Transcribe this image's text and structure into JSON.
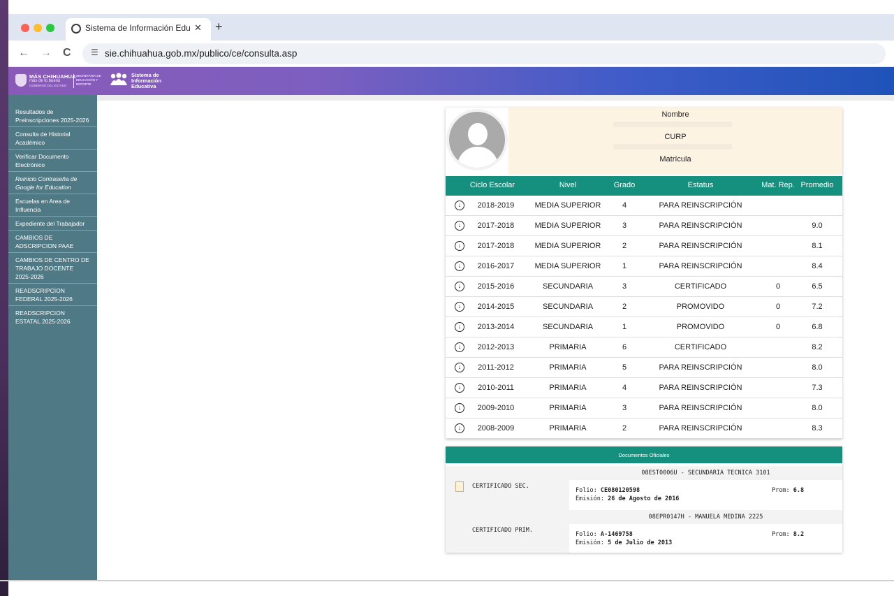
{
  "browser": {
    "tab_title": "Sistema de Información Educ",
    "tab_close": "✕",
    "new_tab": "+",
    "url": "sie.chihuahua.gob.mx/publico/ce/consulta.asp",
    "back": "←",
    "forward": "→",
    "reload": "C",
    "site_icon": "tune-icon",
    "traffic_colors": [
      "#fe5f57",
      "#febc2e",
      "#28c840"
    ]
  },
  "banner": {
    "logo1_line1": "MÁS CHIHUAHUA",
    "logo1_line2": "más de lo bueno",
    "logo1_line3": "GOBIERNO DEL ESTADO",
    "logo1_secretaria": "SECRETARÍA DE EDUCACIÓN Y DEPORTE",
    "logo2_line1": "Sistema de",
    "logo2_line2": "Información",
    "logo2_line3": "Educativa"
  },
  "sidebar": {
    "items": [
      {
        "label": "Resultados de Preinscripciones 2025-2026"
      },
      {
        "label": "Consulta de Historial Académico"
      },
      {
        "label": "Verificar Documento Electrónico"
      },
      {
        "label": "Reinicio Contraseña de Google for Education"
      },
      {
        "label": "Escuelas en Area de Influencia"
      },
      {
        "label": "Expediente del Trabajador"
      },
      {
        "label": "CAMBIOS DE ADSCRIPCION PAAE"
      },
      {
        "label": "CAMBIOS DE CENTRO DE TRABAJO DOCENTE 2025-2026"
      },
      {
        "label": "READSCRIPCION FEDERAL 2025-2026"
      },
      {
        "label": "READSCRIPCION ESTATAL 2025-2026"
      }
    ]
  },
  "student": {
    "nombre_label": "Nombre",
    "curp_label": "CURP",
    "matricula_label": "Matrícula"
  },
  "grid": {
    "headers": {
      "ciclo": "Ciclo Escolar",
      "nivel": "Nivel",
      "grado": "Grado",
      "estatus": "Estatus",
      "matrep": "Mat. Rep.",
      "promedio": "Promedio"
    },
    "rows": [
      {
        "ciclo": "2018-2019",
        "nivel": "MEDIA SUPERIOR",
        "grado": "4",
        "estatus": "PARA REINSCRIPCIÓN",
        "matrep": "",
        "promedio": ""
      },
      {
        "ciclo": "2017-2018",
        "nivel": "MEDIA SUPERIOR",
        "grado": "3",
        "estatus": "PARA REINSCRIPCIÓN",
        "matrep": "",
        "promedio": "9.0"
      },
      {
        "ciclo": "2017-2018",
        "nivel": "MEDIA SUPERIOR",
        "grado": "2",
        "estatus": "PARA REINSCRIPCIÓN",
        "matrep": "",
        "promedio": "8.1"
      },
      {
        "ciclo": "2016-2017",
        "nivel": "MEDIA SUPERIOR",
        "grado": "1",
        "estatus": "PARA REINSCRIPCIÓN",
        "matrep": "",
        "promedio": "8.4"
      },
      {
        "ciclo": "2015-2016",
        "nivel": "SECUNDARIA",
        "grado": "3",
        "estatus": "CERTIFICADO",
        "matrep": "0",
        "promedio": "6.5"
      },
      {
        "ciclo": "2014-2015",
        "nivel": "SECUNDARIA",
        "grado": "2",
        "estatus": "PROMOVIDO",
        "matrep": "0",
        "promedio": "7.2"
      },
      {
        "ciclo": "2013-2014",
        "nivel": "SECUNDARIA",
        "grado": "1",
        "estatus": "PROMOVIDO",
        "matrep": "0",
        "promedio": "6.8"
      },
      {
        "ciclo": "2012-2013",
        "nivel": "PRIMARIA",
        "grado": "6",
        "estatus": "CERTIFICADO",
        "matrep": "",
        "promedio": "8.2"
      },
      {
        "ciclo": "2011-2012",
        "nivel": "PRIMARIA",
        "grado": "5",
        "estatus": "PARA REINSCRIPCIÓN",
        "matrep": "",
        "promedio": "8.0"
      },
      {
        "ciclo": "2010-2011",
        "nivel": "PRIMARIA",
        "grado": "4",
        "estatus": "PARA REINSCRIPCIÓN",
        "matrep": "",
        "promedio": "7.3"
      },
      {
        "ciclo": "2009-2010",
        "nivel": "PRIMARIA",
        "grado": "3",
        "estatus": "PARA REINSCRIPCIÓN",
        "matrep": "",
        "promedio": "8.0"
      },
      {
        "ciclo": "2008-2009",
        "nivel": "PRIMARIA",
        "grado": "2",
        "estatus": "PARA REINSCRIPCIÓN",
        "matrep": "",
        "promedio": "8.3"
      }
    ]
  },
  "documents": {
    "header": "Documentos Oficiales",
    "items": [
      {
        "school": "08EST0006U - SECUNDARIA TECNICA 3101",
        "type": "CERTIFICADO SEC.",
        "folio_label": "Folio:",
        "folio": "CE080120598",
        "emision_label": "Emisión:",
        "emision": "26 de Agosto de 2016",
        "prom_label": "Prom:",
        "prom": "6.8"
      },
      {
        "school": "08EPR0147H - MANUELA MEDINA 2225",
        "type": "CERTIFICADO PRIM.",
        "folio_label": "Folio:",
        "folio": "A-1469758",
        "emision_label": "Emisión:",
        "emision": "5 de Julio de 2013",
        "prom_label": "Prom:",
        "prom": "8.2"
      }
    ]
  }
}
